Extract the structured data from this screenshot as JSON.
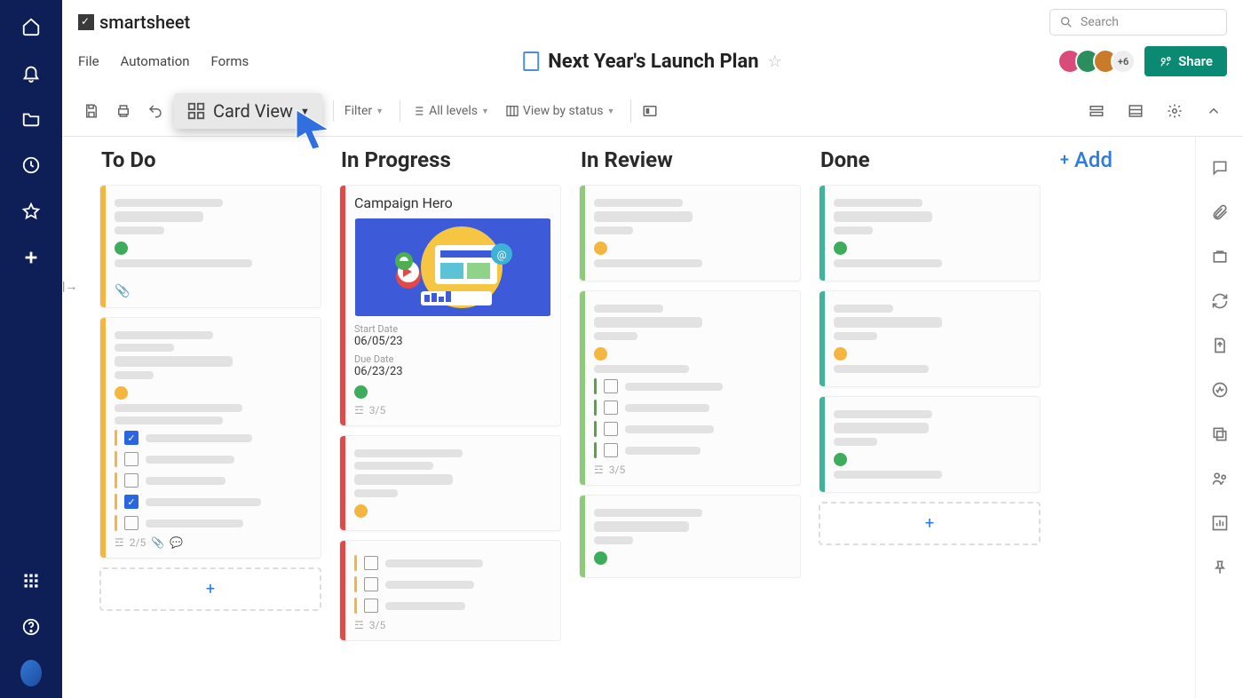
{
  "brand": "smartsheet",
  "search_placeholder": "Search",
  "menu": {
    "file": "File",
    "automation": "Automation",
    "forms": "Forms"
  },
  "sheet": {
    "title": "Next Year's Launch Plan"
  },
  "avatars_more": "+6",
  "share_label": "Share",
  "toolbar": {
    "view_label": "Card View",
    "filter": "Filter",
    "levels": "All levels",
    "view_by": "View by status"
  },
  "add_column": "Add",
  "columns": {
    "todo": {
      "title": "To Do",
      "stripe": "#f4b63f",
      "dots": [
        "#3ead5b",
        "#f4b63f"
      ],
      "footer_count": "2/5"
    },
    "progress": {
      "title": "In Progress",
      "stripe": "#e24a4a",
      "hero_title": "Campaign Hero",
      "start_label": "Start Date",
      "start": "06/05/23",
      "due_label": "Due Date",
      "due": "06/23/23",
      "dot": "#3ead5b",
      "footer_count": "3/5",
      "footer_count2": "3/5"
    },
    "review": {
      "title": "In Review",
      "stripe": "#8fc97a",
      "dots": [
        "#f4b63f",
        "#f4b63f",
        "#3ead5b"
      ],
      "footer_count": "3/5"
    },
    "done": {
      "title": "Done",
      "stripe": "#3fb39c",
      "dots": [
        "#3ead5b",
        "#f4b63f",
        "#3ead5b"
      ]
    }
  },
  "colors": {
    "rail": "#0e1f57",
    "share": "#0a8a72",
    "link": "#2a7de1"
  }
}
